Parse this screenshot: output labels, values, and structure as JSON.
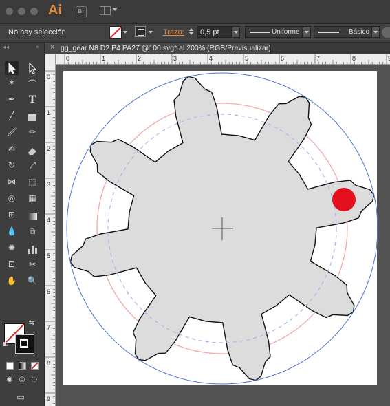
{
  "app": {
    "logo": "Ai",
    "bridge_label": "Br",
    "workspace_icon": "workspace-switcher-icon"
  },
  "control_bar": {
    "selection_label": "No hay selección",
    "stroke_link": "Trazo:",
    "stroke_weight": "0,5 pt",
    "profile_1": "Uniforme",
    "profile_2": "Básico"
  },
  "document_tab": {
    "close": "×",
    "title": "gg_gear N8 D2 P4 PA27 @100.svg* al 200% (RGB/Previsualizar)"
  },
  "rulers": {
    "horizontal_labels": [
      "0",
      "1",
      "2",
      "3",
      "4",
      "5",
      "6",
      "7",
      "8",
      "9"
    ],
    "vertical_labels": [
      "0",
      "1",
      "2",
      "3",
      "4",
      "5",
      "6",
      "7",
      "8",
      "9"
    ]
  },
  "colors": {
    "accent_orange": "#e6893a",
    "gear_fill": "#dcdcdc",
    "outer_circle": "#4a72d6",
    "pitch_circle": "#f3a7a7",
    "base_circle_dashed": "#a9b3ee",
    "marker_red": "#e4101e"
  },
  "tools": [
    "selection-tool",
    "direct-selection-tool",
    "magic-wand-tool",
    "lasso-tool",
    "pen-tool",
    "type-tool",
    "line-segment-tool",
    "rectangle-tool",
    "paintbrush-tool",
    "pencil-tool",
    "blob-brush-tool",
    "eraser-tool",
    "rotate-tool",
    "scale-tool",
    "width-tool",
    "free-transform-tool",
    "shape-builder-tool",
    "perspective-grid-tool",
    "mesh-tool",
    "gradient-tool",
    "eyedropper-tool",
    "blend-tool",
    "symbol-sprayer-tool",
    "column-graph-tool",
    "artboard-tool",
    "slice-tool",
    "hand-tool",
    "zoom-tool"
  ]
}
